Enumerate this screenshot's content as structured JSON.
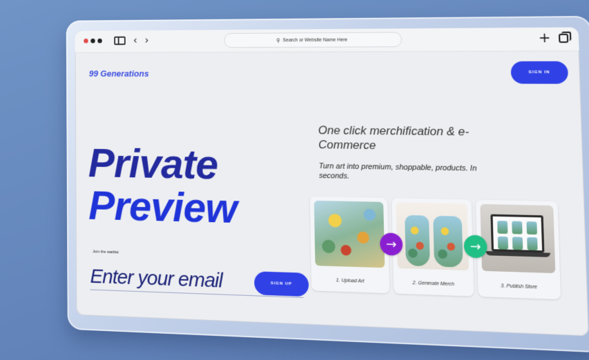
{
  "browser": {
    "address_text": "Search or Website Name Here",
    "search_icon": "search-icon",
    "back_icon": "chevron-left-icon",
    "forward_icon": "chevron-right-icon",
    "new_tab_icon": "plus-icon",
    "tabs_icon": "tabs-icon"
  },
  "header": {
    "brand": "99 Generations",
    "signin_label": "SIGN IN"
  },
  "hero": {
    "title_line1": "Private",
    "title_line2": "Preview",
    "waitlist_label": "Join the waitlist",
    "email_placeholder": "Enter your email",
    "signup_label": "SIGN UP"
  },
  "pitch": {
    "tagline": "One click merchification & e-Commerce",
    "subtext": "Turn art into premium, shoppable, products. In seconds."
  },
  "steps": [
    {
      "caption": "1. Upload Art"
    },
    {
      "caption": "2. Generate Merch"
    },
    {
      "caption": "3. Publish Store"
    }
  ],
  "colors": {
    "accent": "#3042e6",
    "hero_text": "#1f34d8",
    "arrow_purple": "#8a1fd1",
    "arrow_green": "#1fbf85"
  }
}
